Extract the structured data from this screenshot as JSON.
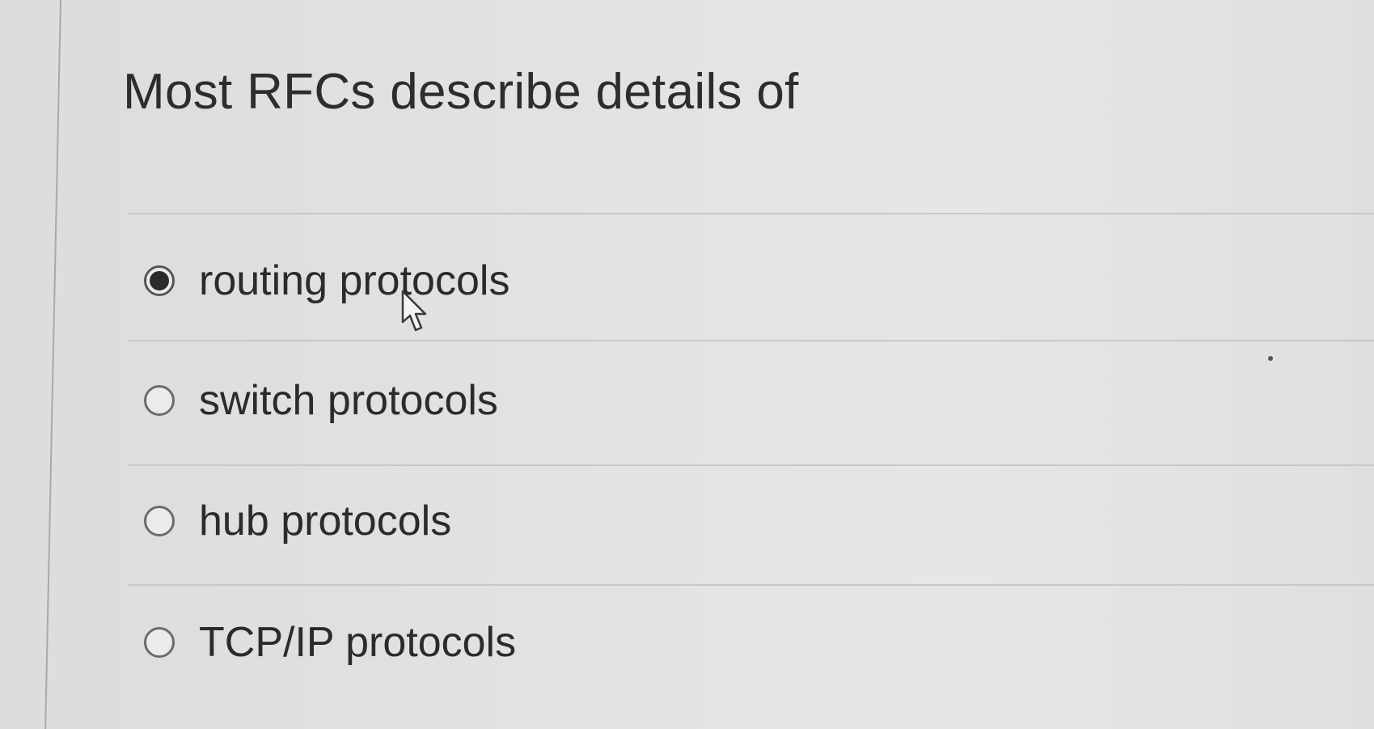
{
  "question": {
    "text": "Most RFCs describe details of"
  },
  "options": [
    {
      "label": "routing protocols",
      "selected": true
    },
    {
      "label": "switch protocols",
      "selected": false
    },
    {
      "label": "hub protocols",
      "selected": false
    },
    {
      "label": "TCP/IP protocols",
      "selected": false
    }
  ],
  "colors": {
    "background": "#dfe0de",
    "text": "#2b2b2b",
    "radio_border": "#6b6b6b",
    "divider": "#c8c9c7"
  },
  "icons": {
    "cursor": "arrow-pointer-icon",
    "radio_selected": "radio-selected-icon",
    "radio_unselected": "radio-unselected-icon"
  }
}
